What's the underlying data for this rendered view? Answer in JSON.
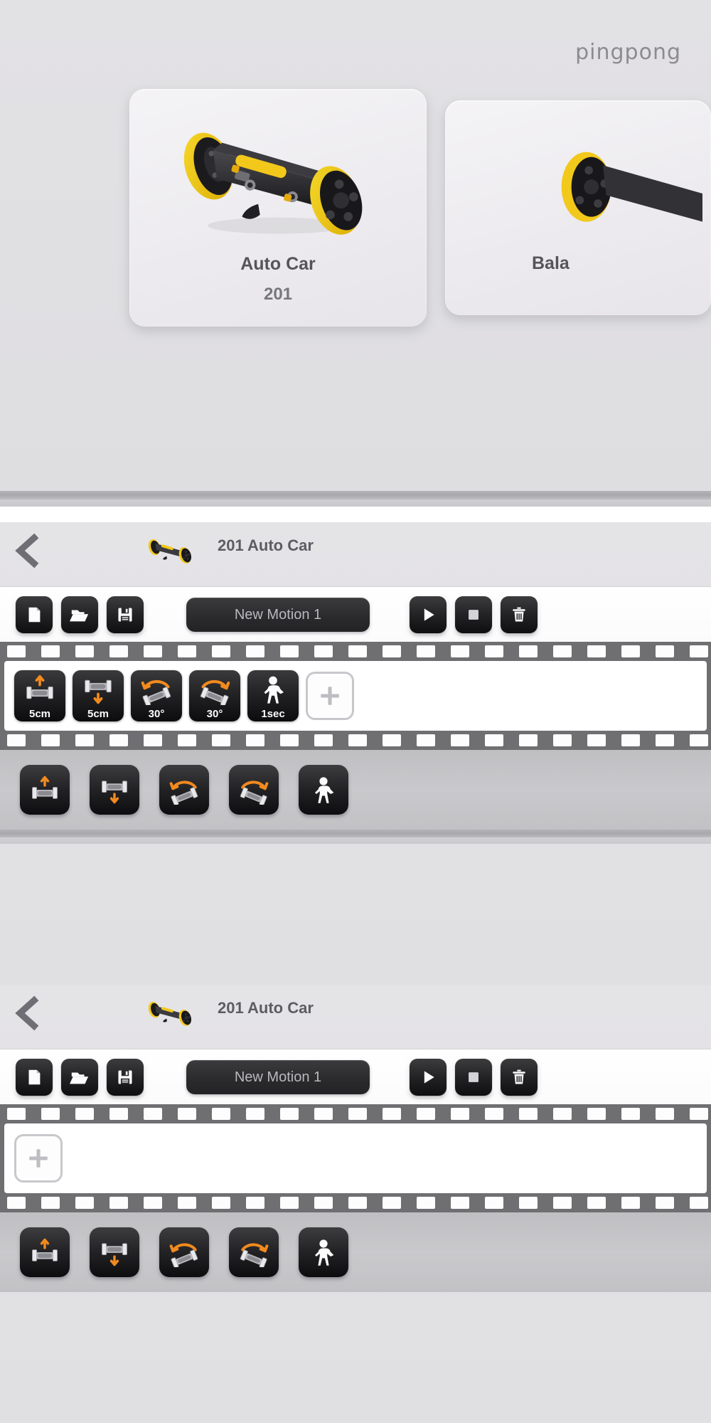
{
  "app": {
    "brand": "pingpong",
    "accent_orange": "#F28A1E",
    "robot_yellow": "#F5CC15",
    "dark_button": "#1d1d1f",
    "film_gray": "#6f6f72"
  },
  "chooser": {
    "cards": [
      {
        "title": "Auto Car",
        "code": "201",
        "art": "robot-auto-car"
      },
      {
        "title": "Bala",
        "code": "",
        "art": "robot-balance"
      }
    ]
  },
  "editors": [
    {
      "header": {
        "back_label": "back-chevron",
        "model_label": "201 Auto Car"
      },
      "toolbar": {
        "new_label": "new-file",
        "open_label": "open-folder",
        "save_label": "save-floppy",
        "motion_name": "New Motion 1",
        "motion_name_placeholder": "New Motion 1",
        "play_label": "play",
        "stop_label": "stop",
        "delete_label": "delete"
      },
      "timeline": {
        "add_label": "+",
        "frames": [
          {
            "caption": "5cm",
            "icon": "move-forward-icon"
          },
          {
            "caption": "5cm",
            "icon": "move-backward-icon"
          },
          {
            "caption": "30°",
            "icon": "turn-left-icon"
          },
          {
            "caption": "30°",
            "icon": "turn-right-icon"
          },
          {
            "caption": "1sec",
            "icon": "wait-person-icon"
          }
        ]
      },
      "palette": [
        {
          "icon": "move-forward-icon",
          "label": "Move forward"
        },
        {
          "icon": "move-backward-icon",
          "label": "Move backward"
        },
        {
          "icon": "turn-left-icon",
          "label": "Turn left"
        },
        {
          "icon": "turn-right-icon",
          "label": "Turn right"
        },
        {
          "icon": "wait-person-icon",
          "label": "Wait"
        }
      ]
    },
    {
      "header": {
        "back_label": "back-chevron",
        "model_label": "201 Auto Car"
      },
      "toolbar": {
        "new_label": "new-file",
        "open_label": "open-folder",
        "save_label": "save-floppy",
        "motion_name": "New Motion 1",
        "motion_name_placeholder": "New Motion 1",
        "play_label": "play",
        "stop_label": "stop",
        "delete_label": "delete"
      },
      "timeline": {
        "add_label": "+",
        "frames": []
      },
      "palette": [
        {
          "icon": "move-forward-icon",
          "label": "Move forward"
        },
        {
          "icon": "move-backward-icon",
          "label": "Move backward"
        },
        {
          "icon": "turn-left-icon",
          "label": "Turn left"
        },
        {
          "icon": "turn-right-icon",
          "label": "Turn right"
        },
        {
          "icon": "wait-person-icon",
          "label": "Wait"
        }
      ]
    }
  ]
}
